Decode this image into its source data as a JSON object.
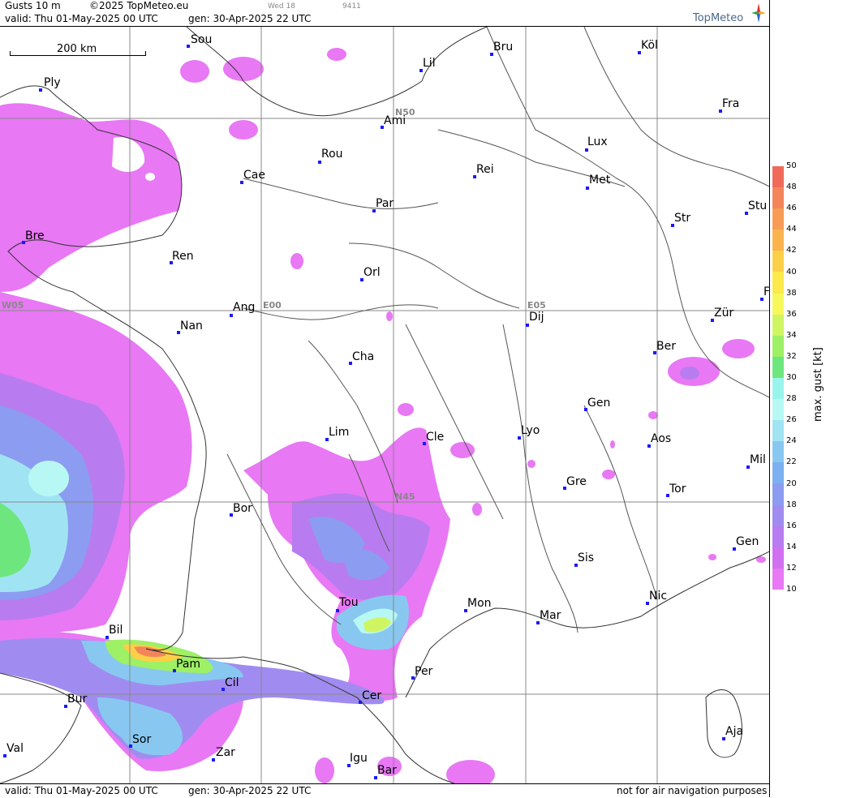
{
  "header": {
    "product": "Gusts 10 m",
    "copyright": "©2025 TopMeteo.eu",
    "valid": "valid:  Thu  01-May-2025  00 UTC",
    "gen": "gen: 30-Apr-2025 22 UTC",
    "small_day": "Wed 18",
    "small_id": "9411",
    "brand": "TopMeteo"
  },
  "footer": {
    "valid": "valid:  Thu  01-May-2025  00 UTC",
    "gen": "gen: 30-Apr-2025 22 UTC",
    "disclaimer": "not for air navigation purposes"
  },
  "scale_bar": {
    "label": "200 km"
  },
  "grid_labels": {
    "n50": "N50",
    "n45": "N45",
    "w05": "W05",
    "e00": "E00",
    "e05": "E05"
  },
  "legend": {
    "title": "max. gust [kt]",
    "ticks": [
      "50",
      "48",
      "46",
      "44",
      "42",
      "40",
      "38",
      "36",
      "34",
      "32",
      "30",
      "28",
      "26",
      "24",
      "22",
      "20",
      "18",
      "16",
      "14",
      "12",
      "10"
    ],
    "colors": [
      "#f06a5a",
      "#f4855a",
      "#f89c55",
      "#fbb34d",
      "#fcd046",
      "#fce94a",
      "#f6f85a",
      "#d0f562",
      "#9ef065",
      "#6ee67e",
      "#9af4ee",
      "#b8f8f4",
      "#a0e4f4",
      "#88c8f0",
      "#7cb0f0",
      "#8c9cf0",
      "#a08cf0",
      "#b87cf0",
      "#d070f0",
      "#e878f4"
    ],
    "colors_note": "top to bottom"
  },
  "cities": [
    {
      "name": "Sou"
    },
    {
      "name": "Bru"
    },
    {
      "name": "Köl"
    },
    {
      "name": "Ply"
    },
    {
      "name": "Lil"
    },
    {
      "name": "Ami"
    },
    {
      "name": "Fra"
    },
    {
      "name": "Lux"
    },
    {
      "name": "Rou"
    },
    {
      "name": "Cae"
    },
    {
      "name": "Rei"
    },
    {
      "name": "Met"
    },
    {
      "name": "Par"
    },
    {
      "name": "Stu"
    },
    {
      "name": "Str"
    },
    {
      "name": "Bre"
    },
    {
      "name": "Ren"
    },
    {
      "name": "Orl"
    },
    {
      "name": "Ang"
    },
    {
      "name": "Dij"
    },
    {
      "name": "Zür"
    },
    {
      "name": "Nan"
    },
    {
      "name": "Ber"
    },
    {
      "name": "Cha"
    },
    {
      "name": "Gen"
    },
    {
      "name": "Lim"
    },
    {
      "name": "Cle"
    },
    {
      "name": "Lyo"
    },
    {
      "name": "Aos"
    },
    {
      "name": "Mil"
    },
    {
      "name": "Gre"
    },
    {
      "name": "Tor"
    },
    {
      "name": "Bor"
    },
    {
      "name": "Gen"
    },
    {
      "name": "Sis"
    },
    {
      "name": "Tou"
    },
    {
      "name": "Nic"
    },
    {
      "name": "Mon"
    },
    {
      "name": "Mar"
    },
    {
      "name": "Bil"
    },
    {
      "name": "Pam"
    },
    {
      "name": "Per"
    },
    {
      "name": "Cil"
    },
    {
      "name": "Cer"
    },
    {
      "name": "Bur"
    },
    {
      "name": "Sor"
    },
    {
      "name": "Aja"
    },
    {
      "name": "Val"
    },
    {
      "name": "Zar"
    },
    {
      "name": "Igu"
    },
    {
      "name": "Bar"
    },
    {
      "name": "F"
    }
  ]
}
